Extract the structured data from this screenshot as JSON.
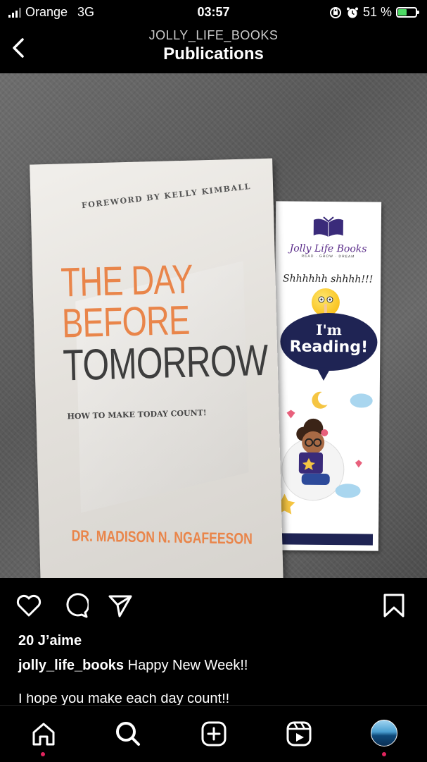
{
  "status_bar": {
    "carrier": "Orange",
    "network": "3G",
    "time": "03:57",
    "battery_percent": "51 %",
    "battery_level": 0.51,
    "icons": [
      "signal-icon",
      "orientation-lock-icon",
      "alarm-icon",
      "battery-charging-icon"
    ]
  },
  "header": {
    "account": "JOLLY_LIFE_BOOKS",
    "title": "Publications"
  },
  "post_image": {
    "book": {
      "foreword": "FOREWORD BY KELLY KIMBALL",
      "title_line1": "THE DAY",
      "title_line2": "BEFORE",
      "title_line3": "TOMORROW",
      "subtitle": "HOW TO MAKE TODAY COUNT!",
      "author": "DR. MADISON N. NGAFEESON"
    },
    "bookmark": {
      "brand": "Jolly Life Books",
      "tagline": "READ · GROW · DREAM",
      "shh_text": "Shhhhhh shhhh!!!",
      "bubble_line1": "I'm",
      "bubble_line2": "Reading!"
    }
  },
  "actions": {
    "icons": [
      "heart-icon",
      "comment-icon",
      "share-icon",
      "bookmark-icon"
    ]
  },
  "post": {
    "likes": "20 J’aime",
    "username": "jolly_life_books",
    "caption": "Happy New Week!!",
    "caption_line2": "I hope you make each day count!!"
  },
  "tab_bar": {
    "items": [
      "home-icon",
      "search-icon",
      "create-icon",
      "reels-icon",
      "profile-avatar"
    ]
  },
  "colors": {
    "background": "#000000",
    "accent_orange": "#e9854a",
    "bookmark_navy": "#1f2454",
    "notification_dot": "#e0245e"
  }
}
